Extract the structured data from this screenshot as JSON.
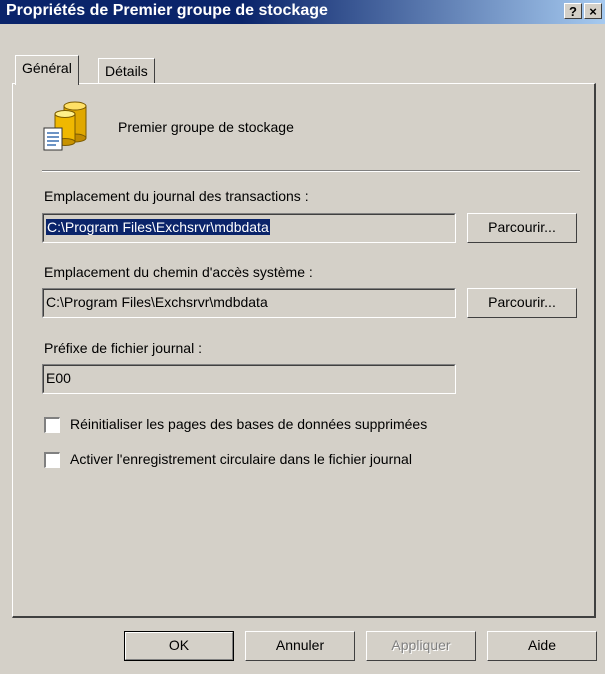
{
  "window": {
    "title": "Propriétés de Premier groupe de stockage",
    "help_button": "?",
    "close_button": "×"
  },
  "tabs": [
    {
      "label": "Général",
      "active": true
    },
    {
      "label": "Détails",
      "active": false
    }
  ],
  "header": {
    "icon": "storage-group-icon",
    "name": "Premier groupe de stockage"
  },
  "transaction_log": {
    "label": "Emplacement du journal des transactions :",
    "value": "C:\\Program Files\\Exchsrvr\\mdbdata",
    "browse_label": "Parcourir..."
  },
  "system_path": {
    "label": "Emplacement du chemin d'accès système :",
    "value": "C:\\Program Files\\Exchsrvr\\mdbdata",
    "browse_label": "Parcourir..."
  },
  "log_prefix": {
    "label": "Préfixe de fichier journal :",
    "value": "E00"
  },
  "options": [
    {
      "label": "Réinitialiser les pages des bases de données supprimées",
      "checked": false
    },
    {
      "label": "Activer l'enregistrement circulaire dans le fichier journal",
      "checked": false
    }
  ],
  "buttons": {
    "ok": "OK",
    "cancel": "Annuler",
    "apply": "Appliquer",
    "help": "Aide"
  },
  "colors": {
    "face": "#d4d0c8",
    "title_bar": "#0a246a",
    "selection": "#0a246a"
  }
}
